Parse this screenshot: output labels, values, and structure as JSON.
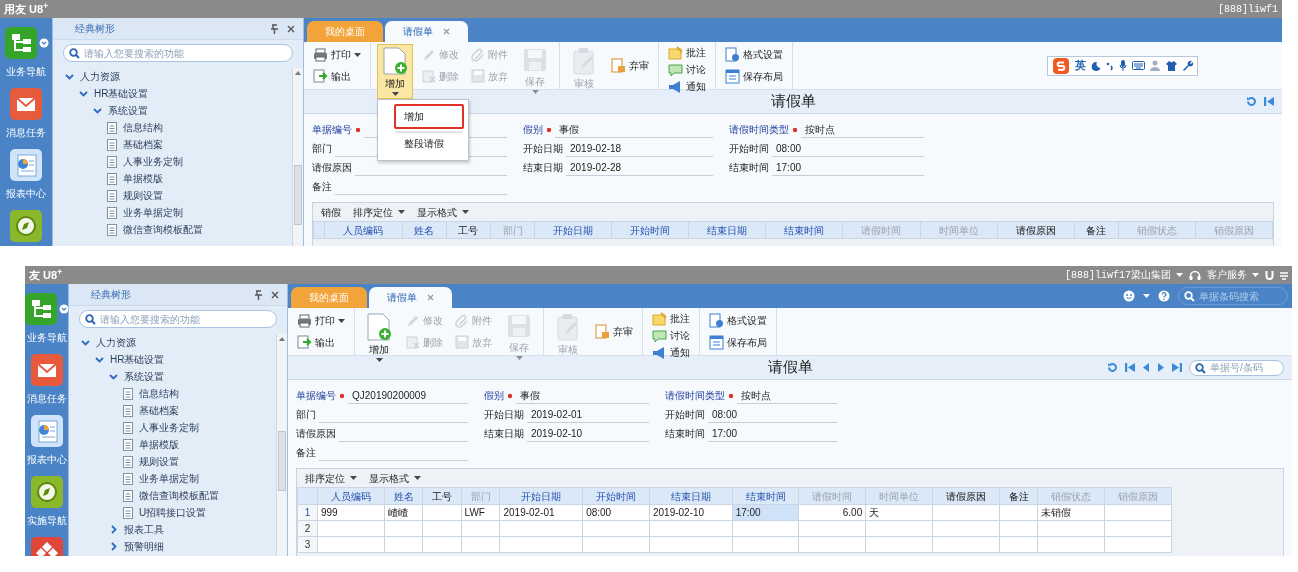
{
  "screens": [
    {
      "title_bar": {
        "app_title": "用友 U8$^{+}$",
        "right": [
          {
            "kind": "account",
            "text": "[888]liwf1",
            "dropdown": false
          }
        ]
      },
      "nav": [
        {
          "kind": "tree",
          "label": "业务导航",
          "dropdown": true
        },
        {
          "kind": "mail",
          "label": "消息任务",
          "dropdown": false
        },
        {
          "kind": "report",
          "label": "报表中心",
          "dropdown": false
        },
        {
          "kind": "compass",
          "dropdown": false
        }
      ],
      "tree_panel": {
        "title": "经典树形",
        "search_placeholder": "请输入您要搜索的功能",
        "items": [
          {
            "label": "人力资源",
            "expanded": true,
            "children": [
              {
                "label": "HR基础设置",
                "expanded": true,
                "children": [
                  {
                    "label": "系统设置",
                    "expanded": true,
                    "children": [
                      {
                        "label": "信息结构"
                      },
                      {
                        "label": "基础档案"
                      },
                      {
                        "label": "人事业务定制"
                      },
                      {
                        "label": "单据模版"
                      },
                      {
                        "label": "规则设置"
                      },
                      {
                        "label": "业务单据定制"
                      },
                      {
                        "label": "微信查询模板配置"
                      }
                    ]
                  }
                ]
              }
            ]
          }
        ]
      },
      "tabs": [
        {
          "label": "我的桌面",
          "selected": false,
          "closable": false
        },
        {
          "label": "请假单",
          "selected": true,
          "closable": true
        }
      ],
      "toolbar": {
        "groups": [
          {
            "columns": [
              [
                {
                  "kind": "printer",
                  "label": "打印",
                  "large": false,
                  "disabled": false,
                  "dropdown": true
                },
                {
                  "kind": "export",
                  "label": "输出",
                  "large": false,
                  "disabled": false,
                  "dropdown": false
                }
              ]
            ]
          },
          {
            "columns": [
              [
                {
                  "kind": "add",
                  "label": "增加",
                  "large": true,
                  "disabled": false,
                  "dropdown": true,
                  "menu": {
                    "items": [
                      {
                        "label": "增加",
                        "selected": true
                      },
                      {
                        "label": "整段请假",
                        "selected": false
                      }
                    ]
                  }
                }
              ],
              [
                {
                  "kind": "pencil",
                  "label": "修改",
                  "large": false,
                  "disabled": true,
                  "dropdown": false
                },
                {
                  "kind": "delete",
                  "label": "删除",
                  "large": false,
                  "disabled": true,
                  "dropdown": false
                }
              ],
              [
                {
                  "kind": "clip",
                  "label": "附件",
                  "large": false,
                  "disabled": true,
                  "dropdown": false
                },
                {
                  "kind": "discard",
                  "label": "放弃",
                  "large": false,
                  "disabled": true,
                  "dropdown": false
                }
              ],
              [
                {
                  "kind": "floppy",
                  "label": "保存",
                  "large": true,
                  "disabled": true,
                  "dropdown": true
                }
              ]
            ]
          },
          {
            "columns": [
              [
                {
                  "kind": "clipboard",
                  "label": "审核",
                  "large": true,
                  "disabled": true,
                  "dropdown": false
                }
              ],
              [
                {
                  "kind": "unaudit",
                  "label": "弃审",
                  "large": false,
                  "disabled": false,
                  "dropdown": false
                }
              ]
            ]
          },
          {
            "columns": [
              [
                {
                  "kind": "note",
                  "label": "批注",
                  "large": false,
                  "disabled": false,
                  "dropdown": false
                },
                {
                  "kind": "discuss",
                  "label": "讨论",
                  "large": false,
                  "disabled": false,
                  "dropdown": false
                },
                {
                  "kind": "notify",
                  "label": "通知",
                  "large": false,
                  "disabled": false,
                  "dropdown": false
                }
              ]
            ]
          },
          {
            "columns": [
              [
                {
                  "kind": "format",
                  "label": "格式设置",
                  "large": false,
                  "disabled": false,
                  "dropdown": false
                },
                {
                  "kind": "layout",
                  "label": "保存布局",
                  "large": false,
                  "disabled": false,
                  "dropdown": false
                }
              ]
            ]
          }
        ]
      },
      "ime_bar": {
        "label": "英"
      },
      "form": {
        "title": "请假单",
        "nav_buttons": [
          {
            "kind": "refresh"
          },
          {
            "kind": "first"
          }
        ],
        "columns": [
          [
            {
              "label": "单据编号",
              "required": true
            },
            {
              "label": "部门",
              "required": false
            },
            {
              "label": "请假原因",
              "required": false
            },
            {
              "label": "备注",
              "required": false
            }
          ],
          [
            {
              "label": "假别",
              "required": true,
              "value": "事假"
            },
            {
              "label": "开始日期",
              "required": false,
              "value": "2019-02-18"
            },
            {
              "label": "结束日期",
              "required": false,
              "value": "2019-02-28"
            }
          ],
          [
            {
              "label": "请假时间类型",
              "required": true,
              "value": "按时点"
            },
            {
              "label": "开始时间",
              "required": false,
              "value": "08:00"
            },
            {
              "label": "结束时间",
              "required": false,
              "value": "17:00"
            }
          ]
        ]
      },
      "grid": {
        "toolbar": [
          {
            "label": "销假",
            "dropdown": false
          },
          {
            "label": "排序定位",
            "dropdown": true
          },
          {
            "label": "显示格式",
            "dropdown": true
          }
        ],
        "columns": [
          {
            "label": "人员编码",
            "kind": "highlighted"
          },
          {
            "label": "姓名",
            "kind": "highlighted"
          },
          {
            "label": "工号",
            "kind": "plain"
          },
          {
            "label": "部门",
            "kind": "inactive"
          },
          {
            "label": "开始日期",
            "kind": "highlighted"
          },
          {
            "label": "开始时间",
            "kind": "highlighted"
          },
          {
            "label": "结束日期",
            "kind": "highlighted"
          },
          {
            "label": "结束时间",
            "kind": "highlighted"
          },
          {
            "label": "请假时间",
            "kind": "inactive"
          },
          {
            "label": "时间单位",
            "kind": "inactive"
          },
          {
            "label": "请假原因",
            "kind": "plain"
          },
          {
            "label": "备注",
            "kind": "plain"
          },
          {
            "label": "销假状态",
            "kind": "inactive"
          },
          {
            "label": "销假原因",
            "kind": "inactive"
          }
        ]
      }
    },
    {
      "title_bar": {
        "app_title": "友 U8$^{+}$",
        "right": [
          {
            "kind": "account",
            "text": "[888]liwf17梁山集团",
            "dropdown": true
          },
          {
            "kind": "service",
            "text": "客户服务",
            "dropdown": true
          },
          {
            "kind": "magnet"
          },
          {
            "kind": "menu"
          }
        ]
      },
      "nav": [
        {
          "kind": "tree",
          "label": "业务导航",
          "dropdown": true
        },
        {
          "kind": "mail",
          "label": "消息任务",
          "dropdown": false
        },
        {
          "kind": "report",
          "label": "报表中心",
          "dropdown": false
        },
        {
          "kind": "compass",
          "label": "实施导航",
          "dropdown": false
        },
        {
          "kind": "puzzle",
          "dropdown": false
        }
      ],
      "tree_panel": {
        "title": "经典树形",
        "search_placeholder": "请输入您要搜索的功能",
        "items": [
          {
            "label": "人力资源",
            "expanded": true,
            "children": [
              {
                "label": "HR基础设置",
                "expanded": true,
                "children": [
                  {
                    "label": "系统设置",
                    "expanded": true,
                    "children": [
                      {
                        "label": "信息结构"
                      },
                      {
                        "label": "基础档案"
                      },
                      {
                        "label": "人事业务定制"
                      },
                      {
                        "label": "单据模版"
                      },
                      {
                        "label": "规则设置"
                      },
                      {
                        "label": "业务单据定制"
                      },
                      {
                        "label": "微信查询模板配置"
                      },
                      {
                        "label": "U招聘接口设置"
                      }
                    ]
                  },
                  {
                    "label": "报表工具",
                    "expanded": false
                  },
                  {
                    "label": "预警明细",
                    "expanded": false
                  }
                ]
              }
            ]
          }
        ]
      },
      "tabs": [
        {
          "label": "我的桌面",
          "selected": false,
          "closable": false
        },
        {
          "label": "请假单",
          "selected": true,
          "closable": true
        }
      ],
      "tab_tools": {
        "search_placeholder": "单据条码搜索"
      },
      "toolbar": {
        "groups": [
          {
            "columns": [
              [
                {
                  "kind": "printer",
                  "label": "打印",
                  "large": false,
                  "disabled": false,
                  "dropdown": true
                },
                {
                  "kind": "export",
                  "label": "输出",
                  "large": false,
                  "disabled": false,
                  "dropdown": false
                }
              ]
            ]
          },
          {
            "columns": [
              [
                {
                  "kind": "add",
                  "label": "增加",
                  "large": true,
                  "disabled": false,
                  "dropdown": true
                }
              ],
              [
                {
                  "kind": "pencil",
                  "label": "修改",
                  "large": false,
                  "disabled": true,
                  "dropdown": false
                },
                {
                  "kind": "delete",
                  "label": "删除",
                  "large": false,
                  "disabled": true,
                  "dropdown": false
                }
              ],
              [
                {
                  "kind": "clip",
                  "label": "附件",
                  "large": false,
                  "disabled": true,
                  "dropdown": false
                },
                {
                  "kind": "discard",
                  "label": "放弃",
                  "large": false,
                  "disabled": true,
                  "dropdown": false
                }
              ],
              [
                {
                  "kind": "floppy",
                  "label": "保存",
                  "large": true,
                  "disabled": true,
                  "dropdown": true
                }
              ]
            ]
          },
          {
            "columns": [
              [
                {
                  "kind": "clipboard",
                  "label": "审核",
                  "large": true,
                  "disabled": true,
                  "dropdown": false
                }
              ],
              [
                {
                  "kind": "unaudit",
                  "label": "弃审",
                  "large": false,
                  "disabled": false,
                  "dropdown": false
                }
              ]
            ]
          },
          {
            "columns": [
              [
                {
                  "kind": "note",
                  "label": "批注",
                  "large": false,
                  "disabled": false,
                  "dropdown": false
                },
                {
                  "kind": "discuss",
                  "label": "讨论",
                  "large": false,
                  "disabled": false,
                  "dropdown": false
                },
                {
                  "kind": "notify",
                  "label": "通知",
                  "large": false,
                  "disabled": false,
                  "dropdown": false
                }
              ]
            ]
          },
          {
            "columns": [
              [
                {
                  "kind": "format",
                  "label": "格式设置",
                  "large": false,
                  "disabled": false,
                  "dropdown": false
                },
                {
                  "kind": "layout",
                  "label": "保存布局",
                  "large": false,
                  "disabled": false,
                  "dropdown": false
                }
              ]
            ]
          }
        ]
      },
      "form": {
        "title": "请假单",
        "nav_buttons": [
          {
            "kind": "refresh"
          },
          {
            "kind": "first"
          },
          {
            "kind": "prev"
          },
          {
            "kind": "next"
          },
          {
            "kind": "last"
          }
        ],
        "search_placeholder": "单据号/条码",
        "columns": [
          [
            {
              "label": "单据编号",
              "required": true,
              "value": "QJ20190200009"
            },
            {
              "label": "部门",
              "required": false
            },
            {
              "label": "请假原因",
              "required": false
            },
            {
              "label": "备注",
              "required": false
            }
          ],
          [
            {
              "label": "假别",
              "required": true,
              "value": "事假"
            },
            {
              "label": "开始日期",
              "required": false,
              "value": "2019-02-01"
            },
            {
              "label": "结束日期",
              "required": false,
              "value": "2019-02-10"
            }
          ],
          [
            {
              "label": "请假时间类型",
              "required": true,
              "value": "按时点"
            },
            {
              "label": "开始时间",
              "required": false,
              "value": "08:00"
            },
            {
              "label": "结束时间",
              "required": false,
              "value": "17:00"
            }
          ]
        ]
      },
      "grid": {
        "toolbar": [
          {
            "label": "排序定位",
            "dropdown": true
          },
          {
            "label": "显示格式",
            "dropdown": true
          }
        ],
        "columns": [
          {
            "label": "人员编码",
            "kind": "highlighted"
          },
          {
            "label": "姓名",
            "kind": "highlighted"
          },
          {
            "label": "工号",
            "kind": "plain"
          },
          {
            "label": "部门",
            "kind": "inactive"
          },
          {
            "label": "开始日期",
            "kind": "highlighted"
          },
          {
            "label": "开始时间",
            "kind": "highlighted"
          },
          {
            "label": "结束日期",
            "kind": "highlighted"
          },
          {
            "label": "结束时间",
            "kind": "highlighted"
          },
          {
            "label": "请假时间",
            "kind": "inactive",
            "numeric": true
          },
          {
            "label": "时间单位",
            "kind": "inactive"
          },
          {
            "label": "请假原因",
            "kind": "plain"
          },
          {
            "label": "备注",
            "kind": "plain"
          },
          {
            "label": "销假状态",
            "kind": "inactive"
          },
          {
            "label": "销假原因",
            "kind": "inactive"
          }
        ],
        "rows": [
          {
            "number": "1",
            "cells": [
              {
                "text": "999",
                "selected": false
              },
              {
                "text": "嵖嵖",
                "selected": false
              },
              {
                "selected": false
              },
              {
                "text": "LWF",
                "selected": false
              },
              {
                "text": "2019-02-01",
                "selected": false
              },
              {
                "text": "08:00",
                "selected": false
              },
              {
                "text": "2019-02-10",
                "selected": false
              },
              {
                "text": "17:00",
                "selected": true
              },
              {
                "text": "6.00",
                "selected": false
              },
              {
                "text": "天",
                "selected": false
              },
              {
                "selected": false
              },
              {
                "selected": false
              },
              {
                "text": "未销假",
                "selected": false
              },
              {
                "selected": false
              }
            ]
          },
          {
            "number": "2"
          },
          {
            "number": "3"
          }
        ]
      }
    }
  ]
}
